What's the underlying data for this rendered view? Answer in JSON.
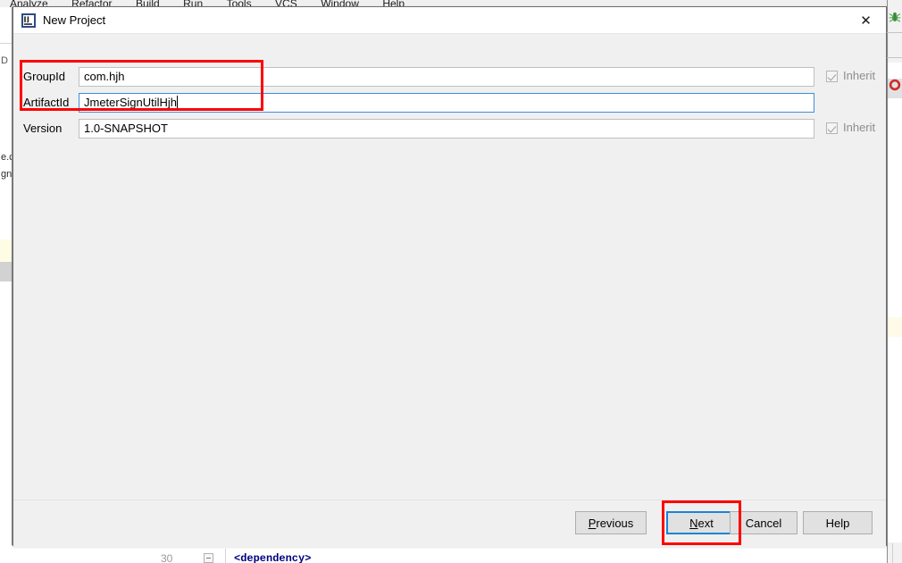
{
  "ide": {
    "menubar": [
      "Analyze",
      "Refactor",
      "Build",
      "Run",
      "Tools",
      "VCS",
      "Window",
      "Help"
    ],
    "left_fragments": {
      "d": "D",
      "ec": "e.c",
      "gn": "gn"
    },
    "right_icons": {
      "bug": "bug-icon",
      "ring": "ring-icon",
      "bug_glyph": "🐞",
      "ring_glyph": "◎"
    },
    "bottom": {
      "line_number": "30",
      "code_fragment": "<dependency>"
    }
  },
  "dialog": {
    "title": "New Project",
    "icon": "intellij-idea-icon",
    "close_label": "✕",
    "fields": [
      {
        "label": "GroupId",
        "value": "com.hjh",
        "focused": false,
        "inherit": {
          "label": "Inherit",
          "checked": true,
          "disabled": true
        }
      },
      {
        "label": "ArtifactId",
        "value": "JmeterSignUtilHjh",
        "focused": true,
        "inherit": null
      },
      {
        "label": "Version",
        "value": "1.0-SNAPSHOT",
        "focused": false,
        "inherit": {
          "label": "Inherit",
          "checked": true,
          "disabled": true
        }
      }
    ],
    "buttons": {
      "previous": {
        "prefix": "",
        "mnemonic": "P",
        "suffix": "revious"
      },
      "next": {
        "prefix": "",
        "mnemonic": "N",
        "suffix": "ext"
      },
      "cancel": {
        "prefix": "",
        "mnemonic": "",
        "suffix": "Cancel"
      },
      "help": {
        "prefix": "",
        "mnemonic": "",
        "suffix": "Help"
      }
    }
  },
  "annotations": {
    "accent_color": "#ff0000",
    "focus_color": "#1a84d6",
    "fields_highlight": "red-rectangle-around-groupid-artifactid",
    "next_highlight": "red-rectangle-around-next-button"
  }
}
